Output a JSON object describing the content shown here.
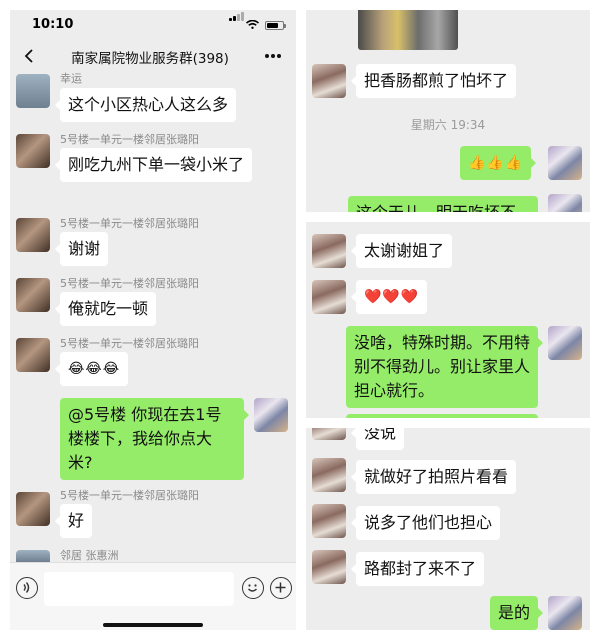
{
  "status": {
    "time": "10:10",
    "battery_level": 0.7
  },
  "chat": {
    "title": "南家属院物业服务群(398)"
  },
  "left_messages": [
    {
      "sender": "幸运",
      "text": "这个小区热心人这么多"
    },
    {
      "sender": "5号楼一单元一楼邻居张璐阳",
      "text": "刚吃九州下单一袋小米了"
    },
    {
      "sender": "5号楼一单元一楼邻居张璐阳",
      "text": "谢谢"
    },
    {
      "sender": "5号楼一单元一楼邻居张璐阳",
      "text": "俺就吃一顿"
    },
    {
      "sender": "5号楼一单元一楼邻居张璐阳",
      "text": "😂😂😂"
    },
    {
      "sender": "",
      "text": "@5号楼 你现在去1号楼楼下，我给你点大米?"
    },
    {
      "sender": "5号楼一单元一楼邻居张璐阳",
      "text": "好"
    },
    {
      "sender": "邻居 张惠洲",
      "text": ""
    }
  ],
  "panel_r1": {
    "messages": [
      {
        "text": "把香肠都煎了怕坏了"
      },
      {
        "text": "👍👍👍"
      },
      {
        "text": "这个天儿，明天吃坏不"
      }
    ],
    "timestamp": "星期六 19:34"
  },
  "panel_r2": {
    "messages": [
      {
        "text": "太谢谢姐了"
      },
      {
        "text": "❤️❤️❤️"
      },
      {
        "text": "没啥，特殊时期。不用特别不得劲儿。别让家里人担心就行。"
      }
    ]
  },
  "panel_r3": {
    "messages": [
      {
        "text": "没说"
      },
      {
        "text": "就做好了拍照片看看"
      },
      {
        "text": "说多了他们也担心"
      },
      {
        "text": "路都封了来不了"
      },
      {
        "text": "是的"
      }
    ]
  },
  "icons": {
    "back": "chevron-left-icon",
    "more": "more-dots-icon",
    "voice": "voice-icon",
    "emoji": "emoji-icon",
    "plus": "plus-icon"
  },
  "colors": {
    "my_bubble": "#95ec69",
    "background": "#ededed"
  }
}
